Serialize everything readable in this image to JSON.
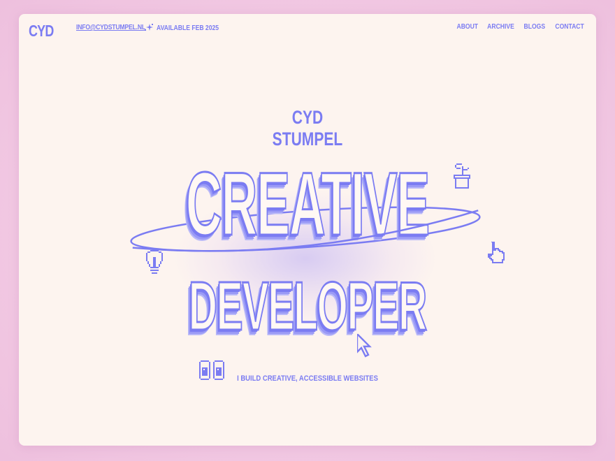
{
  "header": {
    "logo": "CYD",
    "email": "INFO@CYDSTUMPEL.NL",
    "availability": "AVAILABLE FEB 2025"
  },
  "nav": {
    "items": [
      "ABOUT",
      "ARCHIVE",
      "BLOGS",
      "CONTACT"
    ]
  },
  "hero": {
    "first_name": "CYD",
    "last_name": "STUMPEL",
    "word1": "CREATIVE",
    "word2": "DEVELOPER",
    "tagline": "I BUILD CREATIVE, ACCESSIBLE WEBSITES"
  },
  "icons": [
    "sparkle-icon",
    "plant-pot-icon",
    "pointer-hand-icon",
    "lightbulb-icon",
    "arrow-cursor-icon",
    "eyes-icon"
  ],
  "colors": {
    "accent": "#7b7cf2",
    "card_background": "#fdf4ef",
    "page_background": "#f2c9e3"
  }
}
